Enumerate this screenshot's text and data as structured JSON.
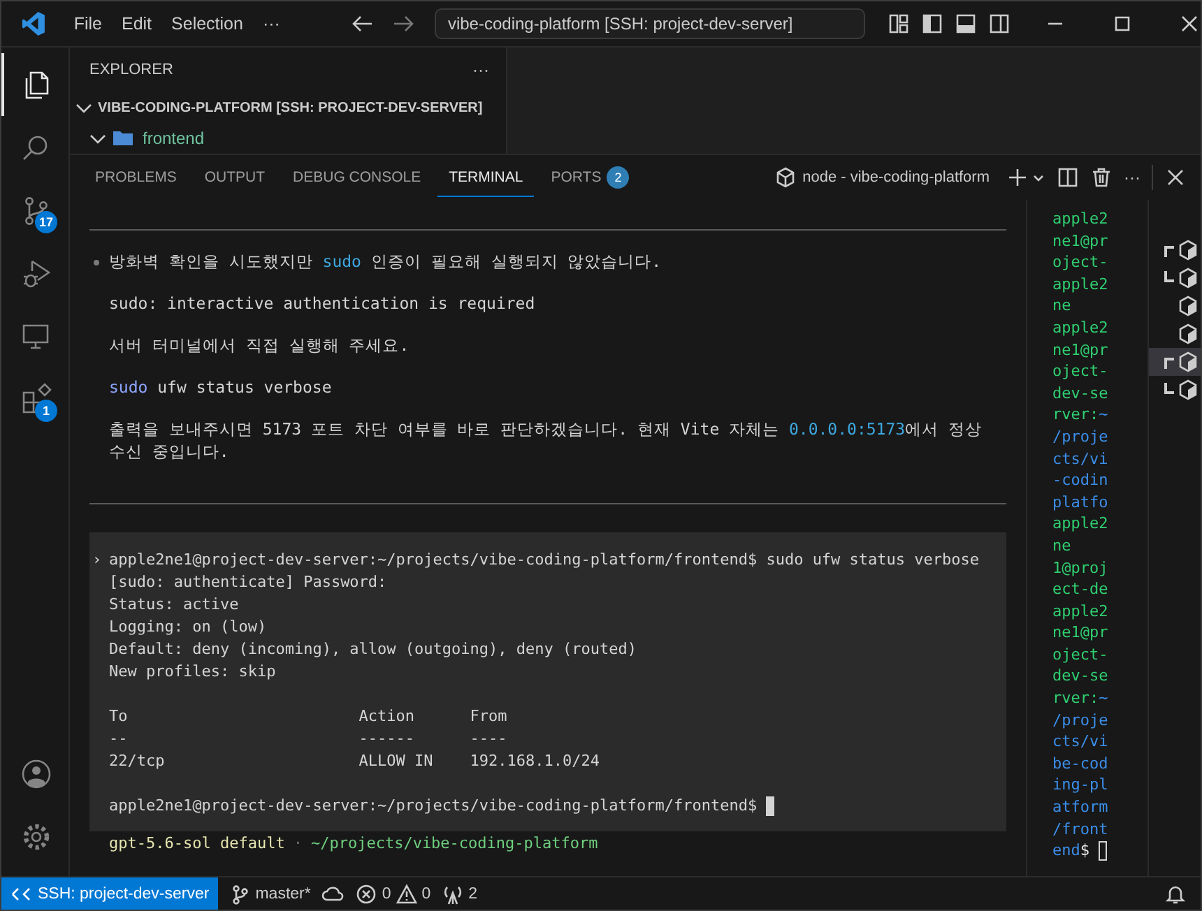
{
  "title_bar": {
    "menus": [
      "File",
      "Edit",
      "Selection"
    ],
    "more": "···",
    "command_center": "vibe-coding-platform [SSH: project-dev-server]"
  },
  "activity_bar": {
    "items": [
      {
        "kind": "files",
        "selected": true
      },
      {
        "kind": "search",
        "selected": false
      },
      {
        "kind": "scm",
        "selected": false,
        "badge": "17"
      },
      {
        "kind": "debug",
        "selected": false
      },
      {
        "kind": "remote",
        "selected": false
      },
      {
        "kind": "extensions",
        "selected": false,
        "badge": "1"
      }
    ],
    "bottom_items": [
      {
        "kind": "account"
      },
      {
        "kind": "settings"
      }
    ]
  },
  "explorer": {
    "title": "EXPLORER",
    "more": "···",
    "root": {
      "label": "VIBE-CODING-PLATFORM [SSH: PROJECT-DEV-SERVER]",
      "expanded": true,
      "children": [
        {
          "label": "frontend",
          "expanded": true
        }
      ]
    }
  },
  "panel": {
    "tabs": [
      {
        "label": "PROBLEMS",
        "selected": false
      },
      {
        "label": "OUTPUT",
        "selected": false
      },
      {
        "label": "DEBUG CONSOLE",
        "selected": false
      },
      {
        "label": "TERMINAL",
        "selected": true
      },
      {
        "label": "PORTS",
        "selected": false,
        "badge": "2"
      }
    ],
    "terminal_name": "node - vibe-coding-platform"
  },
  "terminal": {
    "message": [
      [
        {
          "text": "방화벽 확인을 시도했지만 "
        },
        {
          "text": "sudo",
          "kind": "accent"
        },
        {
          "text": " 인증이 필요해 실행되지 않았습니다."
        }
      ],
      [
        {
          "text": "sudo: interactive authentication is required"
        }
      ],
      [
        {
          "text": "서버 터미널에서 직접 실행해 주세요."
        }
      ],
      [
        {
          "text": "sudo",
          "kind": "command"
        },
        {
          "text": " ufw status verbose"
        }
      ],
      [
        {
          "text": "출력을 보내주시면 5173 포트 차단 여부를 바로 판단하겠습니다. 현재 Vite 자체는 "
        },
        {
          "text": "0.0.0.0:5173",
          "kind": "accent"
        },
        {
          "text": "에서 정상 수신 중입니다."
        }
      ]
    ],
    "output": [
      {
        "kind": "command",
        "marker": "›",
        "text": "apple2ne1@project-dev-server:~/projects/vibe-coding-platform/frontend$ sudo ufw status verbose"
      },
      {
        "kind": "output",
        "text": "[sudo: authenticate] Password:"
      },
      {
        "kind": "output",
        "text": "Status: active"
      },
      {
        "kind": "output",
        "text": "Logging: on (low)"
      },
      {
        "kind": "output",
        "text": "Default: deny (incoming), allow (outgoing), deny (routed)"
      },
      {
        "kind": "output",
        "text": "New profiles: skip"
      },
      {
        "kind": "blank"
      },
      {
        "kind": "output",
        "text": "To                         Action      From"
      },
      {
        "kind": "output",
        "text": "--                         ------      ----"
      },
      {
        "kind": "output",
        "text": "22/tcp                     ALLOW IN    192.168.1.0/24"
      },
      {
        "kind": "blank"
      },
      {
        "kind": "prompt",
        "text": "apple2ne1@project-dev-server:~/projects/vibe-coding-platform/frontend$"
      }
    ],
    "focused": true,
    "status_line": {
      "model": "gpt-5.6-sol default",
      "separator": "·",
      "path": "~/projects/vibe-coding-platform"
    }
  },
  "side_terminal": {
    "focused": false,
    "lines": [
      [
        {
          "text": "apple2",
          "kind": "user"
        }
      ],
      [
        {
          "text": "ne1@pr",
          "kind": "user"
        }
      ],
      [
        {
          "text": "oject-",
          "kind": "user"
        }
      ],
      [
        {
          "text": "apple2",
          "kind": "user"
        }
      ],
      [
        {
          "text": "ne",
          "kind": "user"
        }
      ],
      [
        {
          "text": "apple2",
          "kind": "user"
        }
      ],
      [
        {
          "text": "ne1@pr",
          "kind": "user"
        }
      ],
      [
        {
          "text": "oject-",
          "kind": "user"
        }
      ],
      [
        {
          "text": "dev-se",
          "kind": "user"
        }
      ],
      [
        {
          "text": "rver:",
          "kind": "user"
        },
        {
          "text": "~",
          "kind": "path"
        }
      ],
      [
        {
          "text": "/proje",
          "kind": "path"
        }
      ],
      [
        {
          "text": "cts/vi",
          "kind": "path"
        }
      ],
      [
        {
          "text": "-codin",
          "kind": "path"
        }
      ],
      [
        {
          "text": "platfo",
          "kind": "path"
        }
      ],
      [
        {
          "text": "apple2",
          "kind": "user"
        }
      ],
      [
        {
          "text": "ne",
          "kind": "user"
        }
      ],
      [
        {
          "text": "1@proj",
          "kind": "user"
        }
      ],
      [
        {
          "text": "ect-de",
          "kind": "user"
        }
      ],
      [
        {
          "text": "apple2",
          "kind": "user"
        }
      ],
      [
        {
          "text": "ne1@pr",
          "kind": "user"
        }
      ],
      [
        {
          "text": "oject-",
          "kind": "user"
        }
      ],
      [
        {
          "text": "dev-se",
          "kind": "user"
        }
      ],
      [
        {
          "text": "rver:",
          "kind": "user"
        },
        {
          "text": "~",
          "kind": "path"
        }
      ],
      [
        {
          "text": "/proje",
          "kind": "path"
        }
      ],
      [
        {
          "text": "cts/vi",
          "kind": "path"
        }
      ],
      [
        {
          "text": "be-cod",
          "kind": "path"
        }
      ],
      [
        {
          "text": "ing-pl",
          "kind": "path"
        }
      ],
      [
        {
          "text": "atform",
          "kind": "path"
        }
      ],
      [
        {
          "text": "/front",
          "kind": "path"
        }
      ],
      [
        {
          "text": "end",
          "kind": "path"
        },
        {
          "text": "$",
          "kind": "plain"
        }
      ]
    ]
  },
  "terminal_list": [
    {
      "kind": "split-top",
      "selected": false
    },
    {
      "kind": "split-bottom",
      "selected": false
    },
    {
      "kind": "single",
      "selected": false
    },
    {
      "kind": "single",
      "selected": false
    },
    {
      "kind": "split-top",
      "selected": true
    },
    {
      "kind": "split-bottom",
      "selected": false
    }
  ],
  "status_bar": {
    "remote": "SSH: project-dev-server",
    "branch": "master*",
    "errors": "0",
    "warnings": "0",
    "ports": "2"
  }
}
